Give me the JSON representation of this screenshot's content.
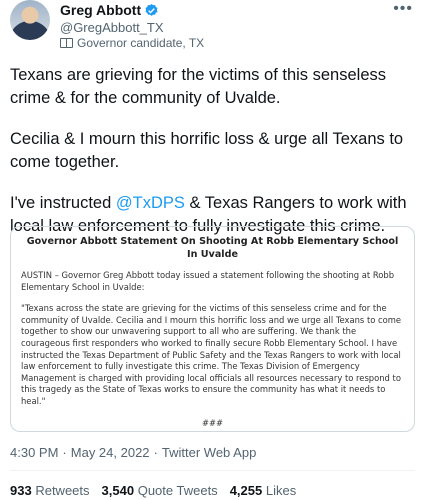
{
  "author": {
    "name": "Greg Abbott",
    "handle": "@GregAbbott_TX",
    "label": "Governor candidate, TX"
  },
  "tweet": {
    "para1": "Texans are grieving for the victims of this senseless crime & for the community of Uvalde.",
    "para2": "Cecilia & I mourn this horrific loss & urge all Texans to come together.",
    "para3_before": "I've instructed ",
    "para3_mention": "@TxDPS",
    "para3_after": " & Texas Rangers to work with local law enforcement to fully investigate this crime."
  },
  "card": {
    "title": "Governor Abbott Statement On Shooting At Robb Elementary School In Uvalde",
    "intro": "AUSTIN – Governor Greg Abbott today issued a statement following the shooting at Robb Elementary School in Uvalde:",
    "quote": "\"Texans across the state are grieving for the victims of this senseless crime and for the community of Uvalde. Cecilia and I mourn this horrific loss and we urge all Texans to come together to show our unwavering support to all who are suffering. We thank the courageous first responders who worked to finally secure Robb Elementary School. I have instructed the Texas Department of Public Safety and the Texas Rangers to work with local law enforcement to fully investigate this crime. The Texas Division of Emergency Management is charged with providing local officials all resources necessary to respond to this tragedy as the State of Texas works to ensure the community has what it needs to heal.\"",
    "end": "###"
  },
  "meta": {
    "time": "4:30 PM",
    "sep1": "·",
    "date": "May 24, 2022",
    "sep2": "·",
    "source": "Twitter Web App"
  },
  "stats": {
    "retweets_num": "933",
    "retweets_label": "Retweets",
    "quotes_num": "3,540",
    "quotes_label": "Quote Tweets",
    "likes_num": "4,255",
    "likes_label": "Likes"
  }
}
